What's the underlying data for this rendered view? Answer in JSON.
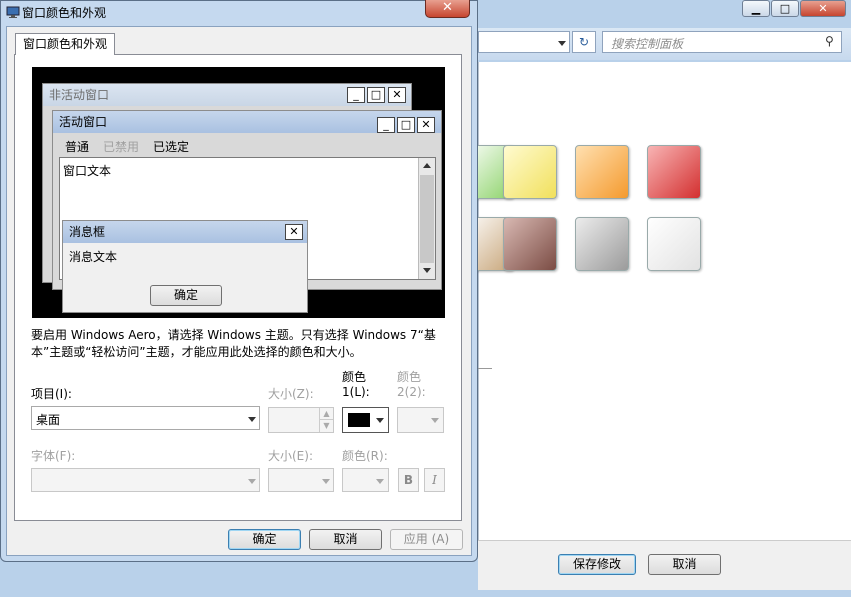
{
  "background": {
    "search_placeholder": "搜索控制面板",
    "title_buttons": [
      "▁",
      "□",
      "✕"
    ],
    "save_label": "保存修改",
    "cancel_label": "取消",
    "swatch_colors": [
      "#8dd36a",
      "#f5e96e",
      "#f7a742",
      "#e04949",
      "#c8a67a",
      "#9b6c63",
      "#b8b8b8",
      "#f1f1f1"
    ]
  },
  "dialog": {
    "title": "窗口颜色和外观",
    "close_glyph": "✕",
    "tab_label": "窗口颜色和外观",
    "preview": {
      "inactive_title": "非活动窗口",
      "active_title": "活动窗口",
      "menu_normal": "普通",
      "menu_disabled": "已禁用",
      "menu_selected": "已选定",
      "window_text": "窗口文本",
      "msgbox_title": "消息框",
      "msgbox_text": "消息文本",
      "msgbox_ok": "确定"
    },
    "info_line1": "要启用 Windows Aero，请选择 Windows 主题。只有选择 Windows 7“基",
    "info_line2": "本”主题或“轻松访问”主题，才能应用此处选择的颜色和大小。",
    "item_label": "项目(I):",
    "item_value": "桌面",
    "size_label": "大小(Z):",
    "color1_label_a": "颜色",
    "color1_label_b": "1(L):",
    "color1_value": "#000000",
    "color2_label_a": "颜色",
    "color2_label_b": "2(2):",
    "font_label": "字体(F):",
    "font_size_label": "大小(E):",
    "font_color_label": "颜色(R):",
    "bold_label": "B",
    "italic_label": "I",
    "ok_label": "确定",
    "cancel_label": "取消",
    "apply_label": "应用 (A)"
  }
}
